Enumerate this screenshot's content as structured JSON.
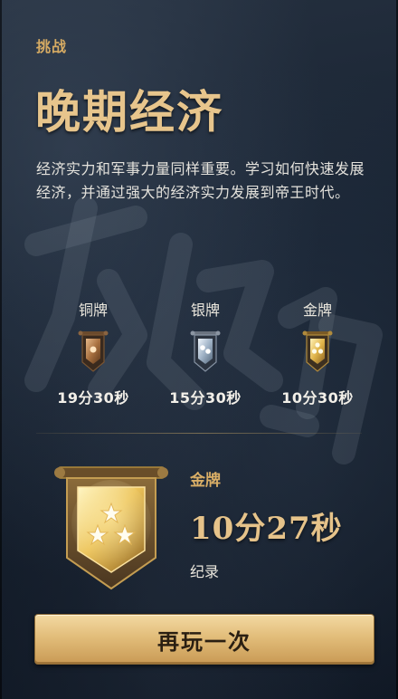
{
  "challenge": {
    "kicker": "挑战",
    "title": "晚期经济",
    "description": "经济实力和军事力量同样重要。学习如何快速发展经济，并通过强大的经济实力发展到帝王时代。"
  },
  "medals": [
    {
      "label": "铜牌",
      "time": "19分30秒",
      "tier": "bronze"
    },
    {
      "label": "银牌",
      "time": "15分30秒",
      "tier": "silver"
    },
    {
      "label": "金牌",
      "time": "10分30秒",
      "tier": "gold"
    }
  ],
  "result": {
    "medal_label": "金牌",
    "time": "10分27秒",
    "note": "纪录",
    "tier": "gold"
  },
  "actions": {
    "replay_label": "再玩一次"
  },
  "colors": {
    "accent_gold": "#d6ab63",
    "title_gold": "#e7c58c",
    "background": "#172231",
    "button_gold": "#e2bd7a"
  },
  "icons": {
    "bronze": "bronze-medal-banner-icon",
    "silver": "silver-medal-banner-icon",
    "gold": "gold-medal-banner-icon"
  }
}
